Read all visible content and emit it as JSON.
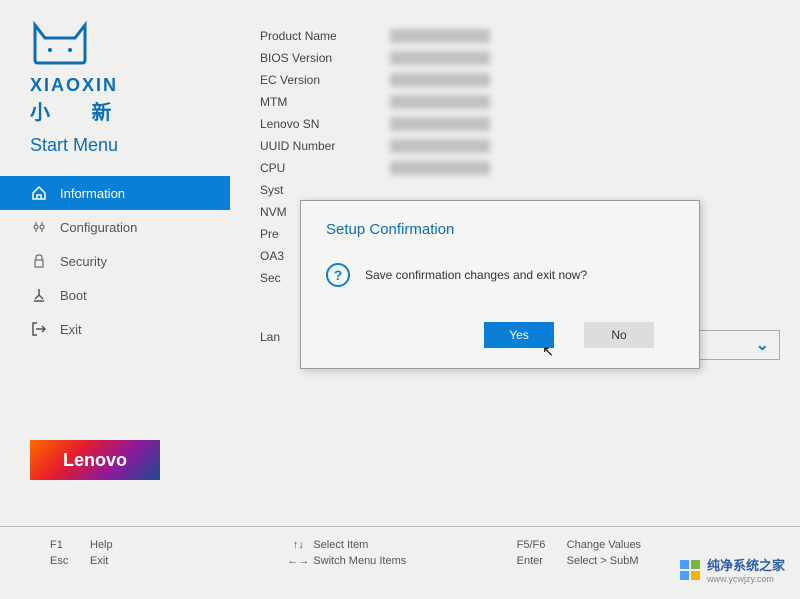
{
  "brand": {
    "name": "XIAOXIN",
    "sub": "小 新",
    "menu_title": "Start Menu"
  },
  "sidebar": {
    "items": [
      {
        "label": "Information",
        "icon": "home"
      },
      {
        "label": "Configuration",
        "icon": "config"
      },
      {
        "label": "Security",
        "icon": "lock"
      },
      {
        "label": "Boot",
        "icon": "boot"
      },
      {
        "label": "Exit",
        "icon": "exit"
      }
    ]
  },
  "info": {
    "rows": [
      "Product Name",
      "BIOS Version",
      "EC Version",
      "MTM",
      "Lenovo SN",
      "UUID Number",
      "CPU",
      "Syst",
      "NVM",
      "Pre",
      "OA3",
      "Sec",
      "Lan"
    ]
  },
  "dialog": {
    "title": "Setup Confirmation",
    "message": "Save confirmation changes and exit now?",
    "yes": "Yes",
    "no": "No"
  },
  "footer": {
    "f1": "F1",
    "help": "Help",
    "esc": "Esc",
    "exit": "Exit",
    "select_item": "Select Item",
    "switch_menu": "Switch Menu Items",
    "f5f6": "F5/F6",
    "change_values": "Change Values",
    "enter": "Enter",
    "select_sub": "Select > SubM"
  },
  "lenovo": "Lenovo",
  "watermark": {
    "text": "纯净系统之家",
    "url": "www.ycwjzy.com"
  }
}
